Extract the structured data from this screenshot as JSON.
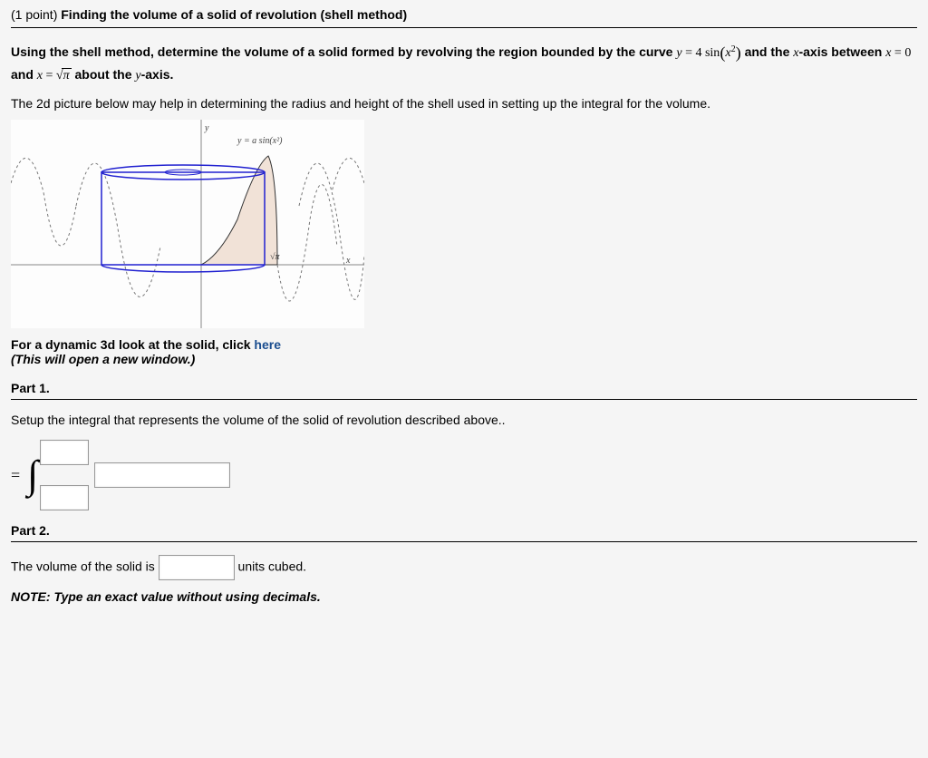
{
  "points": "(1 point)",
  "title": "Finding the volume of a solid of revolution (shell method)",
  "instruction": {
    "prefix": "Using the shell method, determine the volume of a solid formed by revolving the region bounded by the curve ",
    "eq1_lhs": "y",
    "eq1_eq": " = ",
    "eq1_coef": "4",
    "eq1_func": " sin",
    "eq1_arg_var": "x",
    "eq1_arg_exp": "2",
    "mid1": " and the ",
    "xaxis_var": "x",
    "mid2": "-axis between ",
    "eq2_lhs": "x",
    "eq2_eq": " = ",
    "eq2_rhs": "0",
    "mid3": " and ",
    "eq3_lhs": "x",
    "eq3_eq": " = ",
    "sqrt_radicand": "π",
    "mid4": " about the ",
    "yaxis_var": "y",
    "suffix": "-axis."
  },
  "helper_text": "The 2d picture below may help in determining the radius and height of the shell used in setting up the integral for the volume.",
  "figure": {
    "y_label": "y",
    "curve_label": "y = a sin(x²)",
    "sqrt_pi": "√π",
    "x_label": "x"
  },
  "dynamic_link": {
    "prefix": "For a dynamic 3d look at the solid, click ",
    "link_text": "here"
  },
  "dynamic_note": "(This will open a new window.)",
  "part1": {
    "heading": "Part 1.",
    "instruction": "Setup the integral that represents the volume of the solid of revolution described above..",
    "equals": "="
  },
  "part2": {
    "heading": "Part 2.",
    "answer_prefix": "The volume of the solid is ",
    "answer_suffix": " units cubed."
  },
  "note": "NOTE: Type an exact value without using decimals.",
  "chart_data": {
    "type": "line",
    "title": "Region bounded by y = a·sin(x²) on [0, √π] revolved about the y-axis (shell method illustration)",
    "xlabel": "x",
    "ylabel": "y",
    "xlim": [
      -3.2,
      3.2
    ],
    "ylim": [
      -4.2,
      4.2
    ],
    "annotations": [
      "√π",
      "y = a sin(x²)"
    ],
    "series": [
      {
        "name": "y = 4 sin(x²)",
        "x": [
          -3.2,
          -3.0,
          -2.8,
          -2.6,
          -2.4,
          -2.2,
          -2.0,
          -1.8,
          -1.6,
          -1.4,
          -1.2,
          -1.0,
          -0.8,
          -0.6,
          -0.4,
          -0.2,
          0.0,
          0.2,
          0.4,
          0.6,
          0.8,
          1.0,
          1.2,
          1.4,
          1.6,
          1.8,
          1.9,
          2.0,
          2.2,
          2.4,
          2.6,
          2.8,
          3.0,
          3.2
        ],
        "y": [
          -2.73,
          1.65,
          3.99,
          1.83,
          -2.01,
          -3.96,
          -3.03,
          -0.39,
          2.19,
          3.7,
          3.97,
          3.37,
          2.39,
          1.41,
          0.64,
          0.16,
          0.0,
          0.16,
          0.64,
          1.41,
          2.39,
          3.37,
          3.97,
          3.7,
          2.19,
          -0.39,
          -1.8,
          -3.03,
          -3.96,
          -2.01,
          1.83,
          3.99,
          1.65,
          -2.73
        ]
      }
    ],
    "shaded_region": {
      "x_from": 0,
      "x_to": 1.7725,
      "curve": "4 sin(x²)",
      "baseline": 0
    },
    "shell_rectangle": {
      "x_left": -1.2,
      "x_right": 1.2,
      "y_top": 2.6,
      "y_bottom": 0
    }
  }
}
